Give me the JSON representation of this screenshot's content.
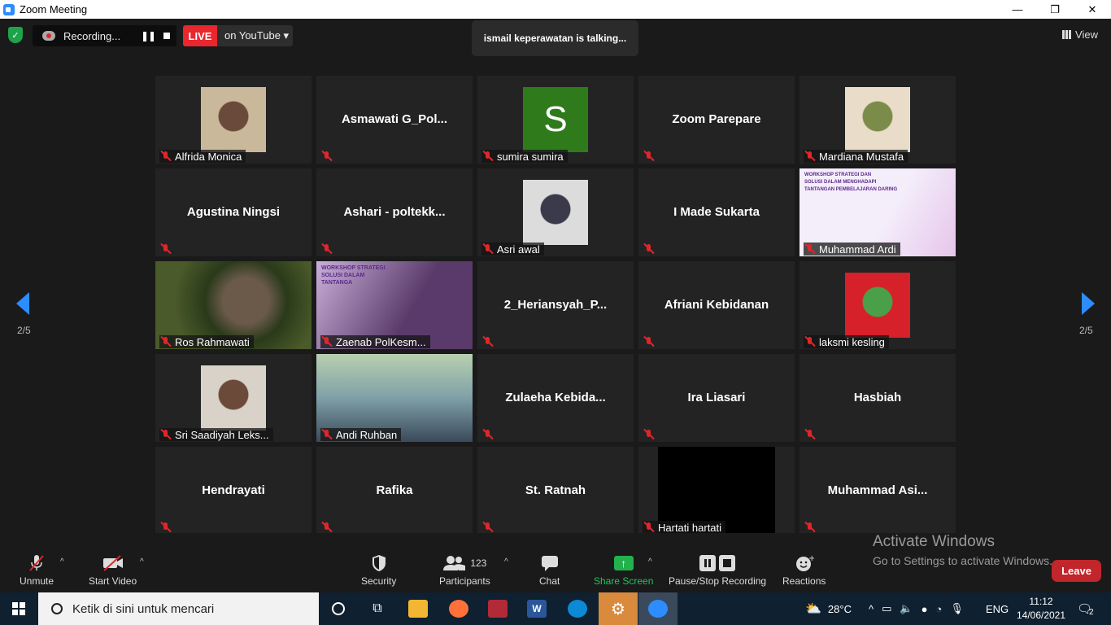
{
  "window": {
    "title": "Zoom Meeting",
    "minimize": "—",
    "restore": "❐",
    "close": "✕"
  },
  "topbar": {
    "recording_label": "Recording...",
    "live_label": "LIVE",
    "live_target": "on YouTube ▾",
    "talking": "ismail keperawatan is talking...",
    "view_label": "View"
  },
  "pager": {
    "left": "2/5",
    "right": "2/5"
  },
  "tiles": [
    {
      "label": "Alfrida Monica",
      "big": ""
    },
    {
      "label": "",
      "big": "Asmawati  G_Pol..."
    },
    {
      "label": "sumira sumira",
      "big": "",
      "avatar": "S"
    },
    {
      "label": "",
      "big": "Zoom Parepare"
    },
    {
      "label": "Mardiana Mustafa",
      "big": ""
    },
    {
      "label": "",
      "big": "Agustina Ningsi"
    },
    {
      "label": "",
      "big": "Ashari  -  poltekk..."
    },
    {
      "label": "Asri awal",
      "big": ""
    },
    {
      "label": "",
      "big": "I Made Sukarta"
    },
    {
      "label": "Muhammad Ardi",
      "big": ""
    },
    {
      "label": "Ros Rahmawati",
      "big": ""
    },
    {
      "label": "Zaenab PolKesm...",
      "big": ""
    },
    {
      "label": "",
      "big": "2_Heriansyah_P..."
    },
    {
      "label": "",
      "big": "Afriani Kebidanan"
    },
    {
      "label": "laksmi kesling",
      "big": ""
    },
    {
      "label": "Sri Saadiyah Leks...",
      "big": ""
    },
    {
      "label": "Andi Ruhban",
      "big": ""
    },
    {
      "label": "",
      "big": "Zulaeha  Kebida..."
    },
    {
      "label": "",
      "big": "Ira Liasari"
    },
    {
      "label": "",
      "big": "Hasbiah"
    },
    {
      "label": "",
      "big": "Hendrayati"
    },
    {
      "label": "",
      "big": "Rafika"
    },
    {
      "label": "",
      "big": "St. Ratnah"
    },
    {
      "label": "Hartati hartati",
      "big": ""
    },
    {
      "label": "",
      "big": "Muhammad  Asi..."
    }
  ],
  "slide": {
    "line1": "WORKSHOP STRATEGI DAN",
    "line2": "SOLUSI DALAM MENGHADAPI",
    "line3": "TANTANGAN PEMBELAJARAN DARING",
    "short1": "WORKSHOP STRATEGI",
    "short2": "SOLUSI DALAM",
    "short3": "TANTANGA"
  },
  "toolbar": {
    "unmute": "Unmute",
    "start_video": "Start Video",
    "security": "Security",
    "participants": "Participants",
    "participants_count": "123",
    "chat": "Chat",
    "share": "Share Screen",
    "record": "Pause/Stop Recording",
    "reactions": "Reactions",
    "leave": "Leave"
  },
  "activation": {
    "line1": "Activate Windows",
    "line2": "Go to Settings to activate Windows."
  },
  "taskbar": {
    "search_placeholder": "Ketik di sini untuk mencari",
    "weather": "28°C",
    "lang": "ENG",
    "time": "11:12",
    "date": "14/06/2021",
    "notif_count": "2"
  },
  "colors": {
    "accent": "#2d8cff",
    "live": "#e8272e",
    "leave": "#c0262b",
    "share": "#22b14c"
  }
}
